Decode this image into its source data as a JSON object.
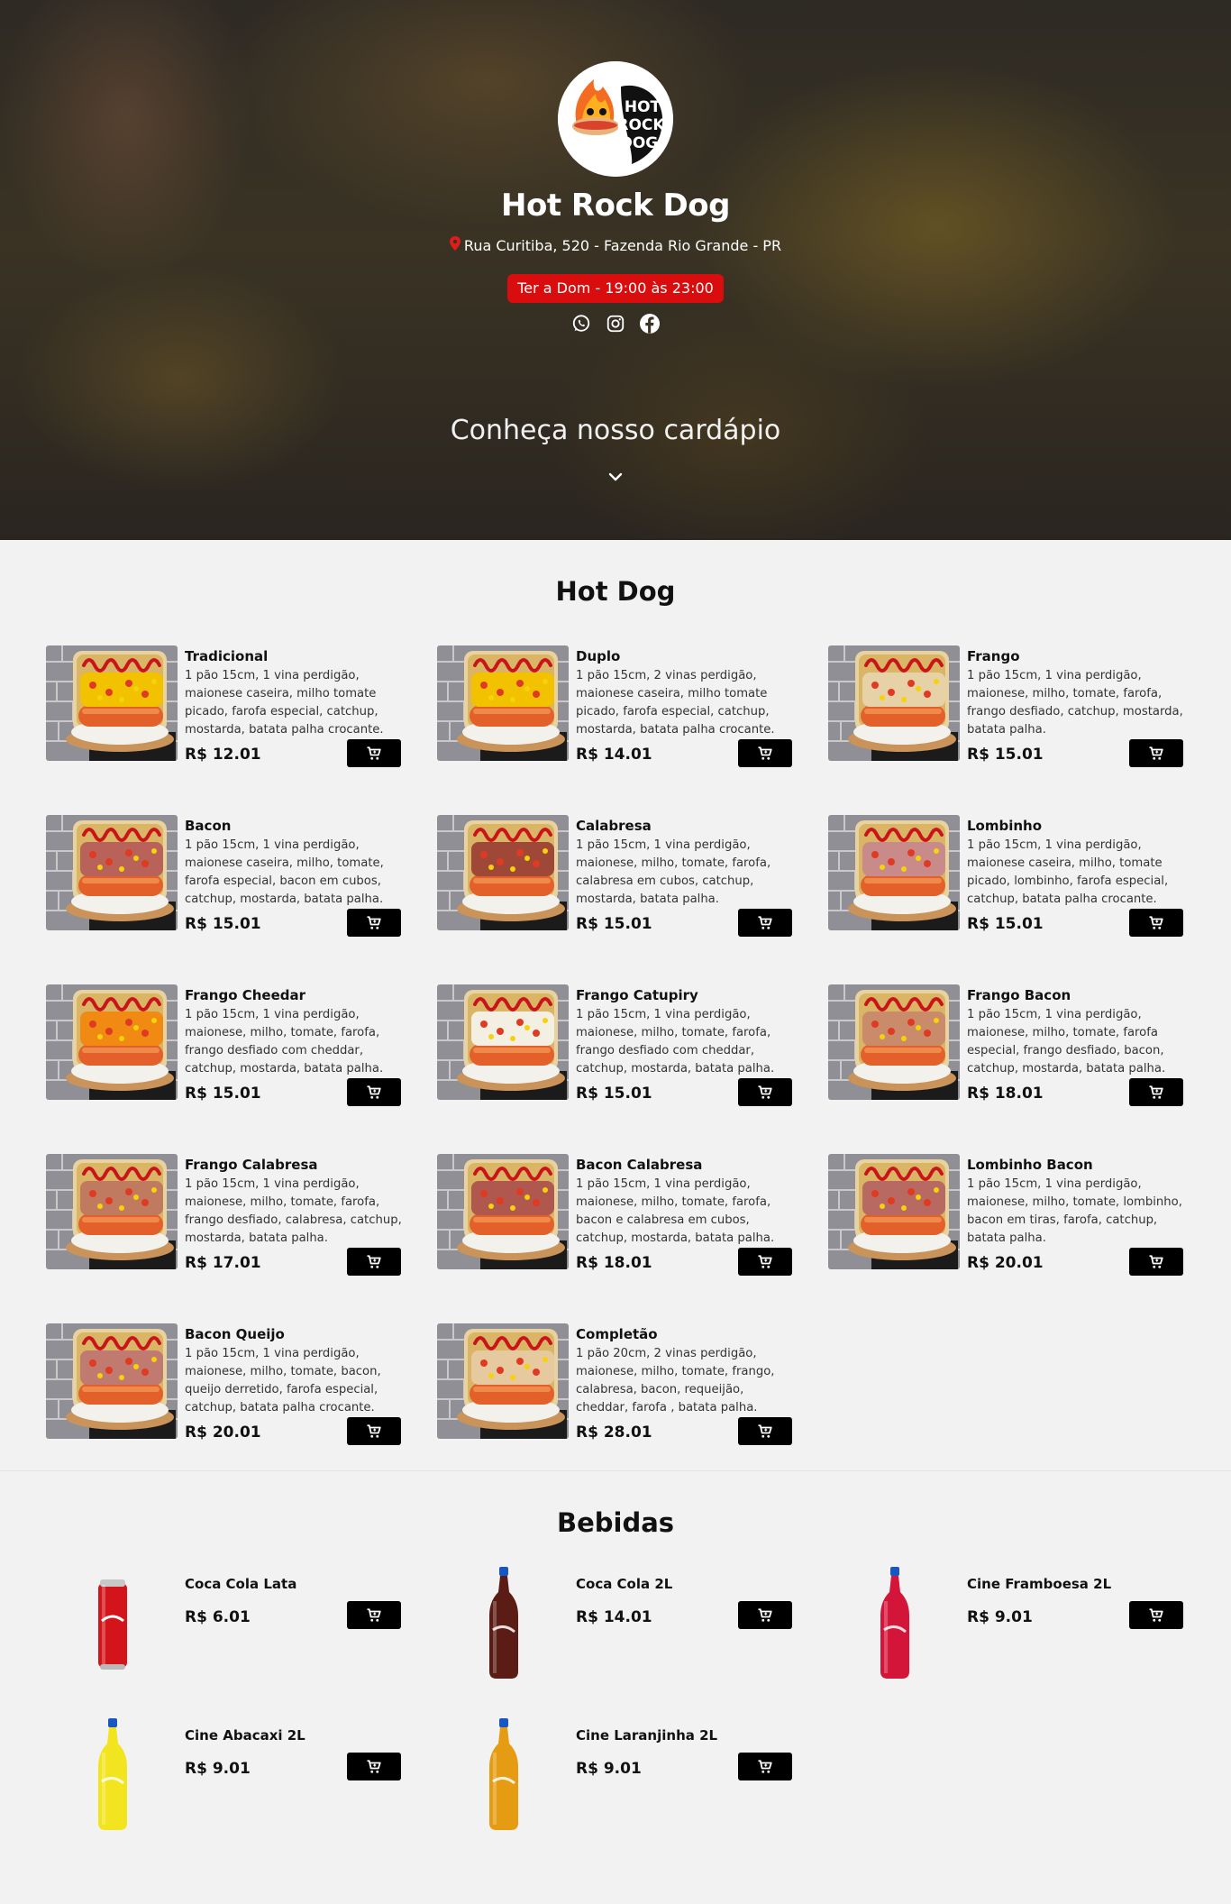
{
  "header": {
    "logo_text": [
      "HOT",
      "ROCK",
      "DOG"
    ],
    "brand": "Hot Rock Dog",
    "address": "Rua Curitiba, 520 - Fazenda Rio Grande - PR",
    "hours": "Ter a Dom - 19:00 às 23:00",
    "socials": [
      "whatsapp-icon",
      "instagram-icon",
      "facebook-icon"
    ],
    "tagline": "Conheça nosso cardápio"
  },
  "colors": {
    "accent_red": "#d90d0d",
    "cart_button": "#000000",
    "page_bg": "#f2f2f2"
  },
  "hotdogs": {
    "title": "Hot Dog",
    "items": [
      {
        "name": "Tradicional",
        "desc": "1 pão 15cm, 1 vina perdigão, maionese caseira, milho tomate picado, farofa especial, catchup, mostarda, batata palha crocante.",
        "price": "R$ 12.01",
        "topping": "#f2c200"
      },
      {
        "name": "Duplo",
        "desc": "1 pão 15cm, 2 vinas perdigão, maionese caseira, milho tomate picado, farofa especial, catchup, mostarda, batata palha crocante.",
        "price": "R$ 14.01",
        "topping": "#f2c200"
      },
      {
        "name": "Frango",
        "desc": "1 pão 15cm, 1 vina perdigão, maionese, milho, tomate, farofa, frango desfiado, catchup, mostarda, batata palha.",
        "price": "R$ 15.01",
        "topping": "#e7d2a8"
      },
      {
        "name": "Bacon",
        "desc": "1 pão 15cm, 1 vina perdigão, maionese caseira, milho, tomate, farofa especial, bacon em cubos, catchup, mostarda, batata palha.",
        "price": "R$ 15.01",
        "topping": "#b8625a"
      },
      {
        "name": "Calabresa",
        "desc": "1 pão 15cm, 1 vina perdigão, maionese, milho, tomate, farofa, calabresa em cubos, catchup, mostarda, batata palha.",
        "price": "R$ 15.01",
        "topping": "#a04838"
      },
      {
        "name": "Lombinho",
        "desc": "1 pão 15cm, 1 vina perdigão, maionese caseira, milho, tomate picado, lombinho, farofa especial, catchup, batata palha crocante.",
        "price": "R$ 15.01",
        "topping": "#c98b8a"
      },
      {
        "name": "Frango Cheedar",
        "desc": "1 pão 15cm, 1 vina perdigão, maionese, milho, tomate, farofa, frango desfiado com cheddar, catchup, mostarda, batata palha.",
        "price": "R$ 15.01",
        "topping": "#f08a12"
      },
      {
        "name": "Frango Catupiry",
        "desc": "1 pão 15cm, 1 vina perdigão, maionese, milho, tomate, farofa, frango desfiado com cheddar, catchup, mostarda, batata palha.",
        "price": "R$ 15.01",
        "topping": "#f3efe3"
      },
      {
        "name": "Frango Bacon",
        "desc": "1 pão 15cm, 1 vina perdigão, maionese, milho, tomate, farofa especial, frango desfiado, bacon, catchup, mostarda, batata palha.",
        "price": "R$ 18.01",
        "topping": "#c98b6a"
      },
      {
        "name": "Frango Calabresa",
        "desc": "1 pão 15cm, 1 vina perdigão, maionese, milho, tomate, farofa, frango desfiado, calabresa, catchup, mostarda, batata palha.",
        "price": "R$ 17.01",
        "topping": "#c07a60"
      },
      {
        "name": "Bacon Calabresa",
        "desc": "1 pão 15cm, 1 vina perdigão, maionese, milho, tomate, farofa, bacon e calabresa em cubos, catchup, mostarda, batata palha.",
        "price": "R$ 18.01",
        "topping": "#b0574e"
      },
      {
        "name": "Lombinho Bacon",
        "desc": "1 pão 15cm, 1 vina perdigão, maionese, milho, tomate, lombinho, bacon em tiras, farofa, catchup, batata palha.",
        "price": "R$ 20.01",
        "topping": "#b86a62"
      },
      {
        "name": "Bacon Queijo",
        "desc": "1 pão 15cm, 1 vina perdigão, maionese, milho, tomate, bacon, queijo derretido, farofa especial, catchup, batata palha crocante.",
        "price": "R$ 20.01",
        "topping": "#c07a70"
      },
      {
        "name": "Completão",
        "desc": "1 pão 20cm, 2 vinas perdigão, maionese, milho, tomate, frango, calabresa, bacon, requeijão, cheddar, farofa , batata palha.",
        "price": "R$ 28.01",
        "topping": "#e7c9a0"
      }
    ]
  },
  "drinks": {
    "title": "Bebidas",
    "items": [
      {
        "name": "Coca Cola Lata",
        "price": "R$ 6.01",
        "kind": "can",
        "color": "#d3151b"
      },
      {
        "name": "Coca Cola 2L",
        "price": "R$ 14.01",
        "kind": "bottle",
        "color": "#5a1c14"
      },
      {
        "name": "Cine Framboesa 2L",
        "price": "R$ 9.01",
        "kind": "bottle",
        "color": "#d4153a"
      },
      {
        "name": "Cine Abacaxi 2L",
        "price": "R$ 9.01",
        "kind": "bottle",
        "color": "#f2e520"
      },
      {
        "name": "Cine Laranjinha 2L",
        "price": "R$ 9.01",
        "kind": "bottle",
        "color": "#e59b12"
      }
    ]
  }
}
